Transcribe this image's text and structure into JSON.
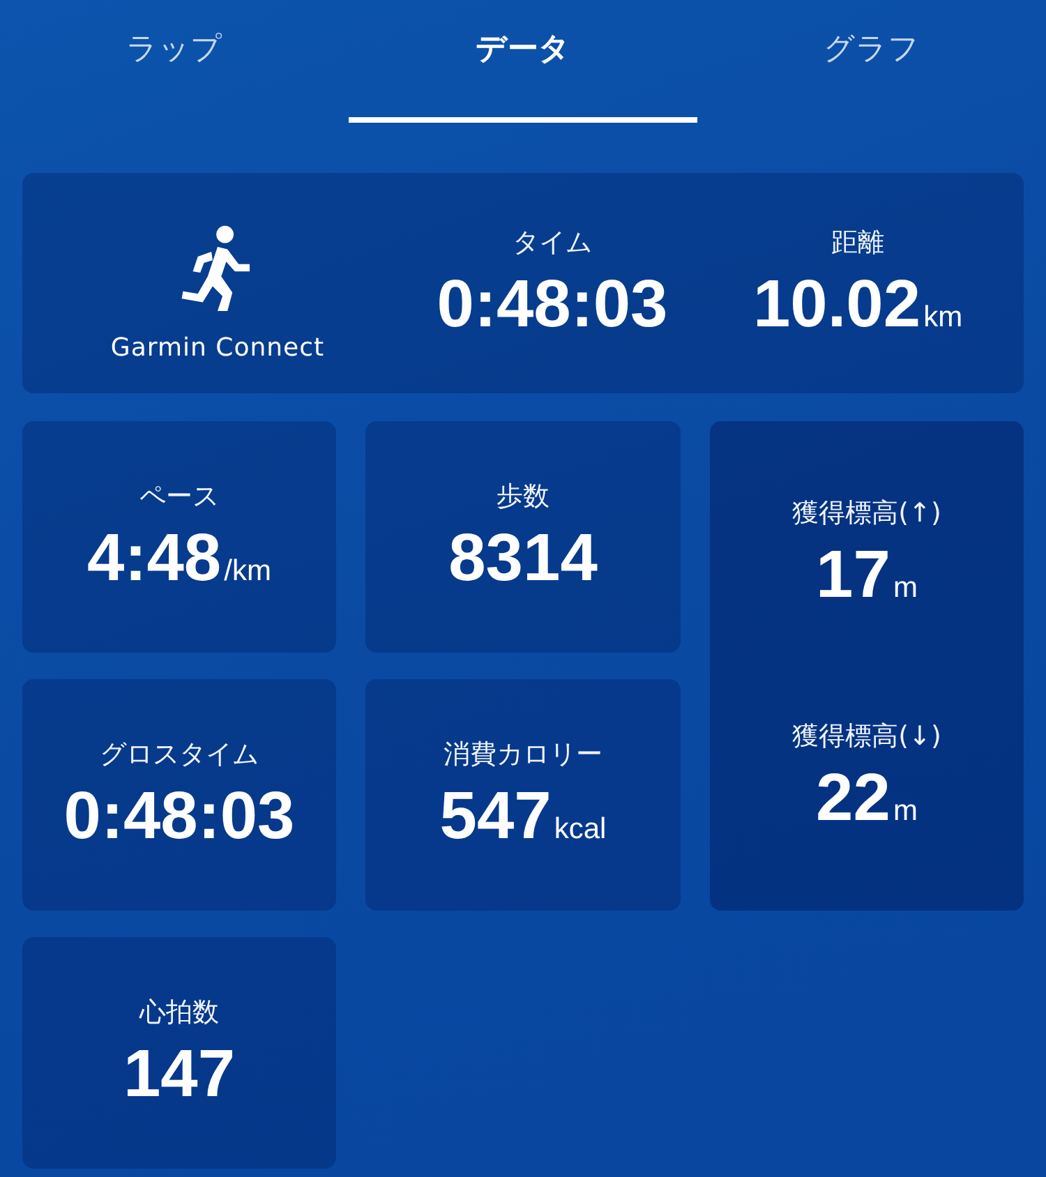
{
  "tabs": [
    {
      "label": "ラップ",
      "selected": false
    },
    {
      "label": "データ",
      "selected": true
    },
    {
      "label": "グラフ",
      "selected": false
    }
  ],
  "summary": {
    "app_label": "Garmin Connect",
    "metrics": [
      {
        "label": "タイム",
        "value": "0:48:03"
      },
      {
        "label": "距離",
        "value": "10.02",
        "unit": "km"
      }
    ]
  },
  "cards": [
    {
      "kind": "single",
      "metrics": [
        {
          "label": "ペース",
          "value": "4:48",
          "unit": "/km"
        }
      ]
    },
    {
      "kind": "single",
      "metrics": [
        {
          "label": "歩数",
          "value": "8314"
        }
      ]
    },
    {
      "kind": "stacked",
      "metrics": [
        {
          "label": "獲得標高(↑)",
          "value": "17",
          "unit": "m"
        },
        {
          "label": "獲得標高(↓)",
          "value": "22",
          "unit": "m"
        }
      ]
    },
    {
      "kind": "single",
      "metrics": [
        {
          "label": "グロスタイム",
          "value": "0:48:03"
        }
      ]
    },
    {
      "kind": "single",
      "metrics": [
        {
          "label": "消費カロリー",
          "value": "547",
          "unit": "kcal"
        }
      ]
    },
    {
      "kind": "single",
      "metrics": [
        {
          "label": "心拍数",
          "value": "147"
        }
      ]
    }
  ]
}
